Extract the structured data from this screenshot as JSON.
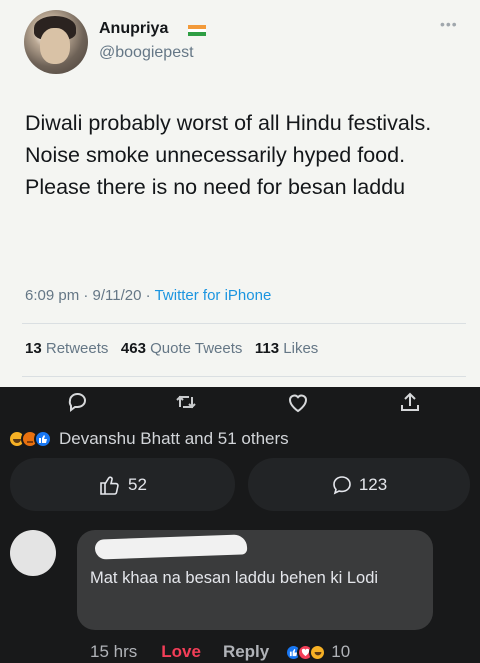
{
  "tweet": {
    "user_name": "Anupriya",
    "handle": "@boogiepest",
    "text": "Diwali probably worst of all Hindu festivals. Noise smoke unnecessarily hyped food. Please there is no need for besan laddu",
    "time": "6:09 pm",
    "date": "9/11/20",
    "source": "Twitter for iPhone",
    "retweets_count": "13",
    "retweets_label": "Retweets",
    "quote_count": "463",
    "quote_label": "Quote Tweets",
    "likes_count": "113",
    "likes_label": "Likes",
    "icons": [
      "more-icon",
      "reply-icon",
      "retweet-icon",
      "like-icon",
      "share-icon",
      "flag-icon"
    ]
  },
  "facebook": {
    "reactions_summary": "Devanshu Bhatt and 51 others",
    "reaction_icons": [
      "haha-icon",
      "angry-icon",
      "like-icon"
    ],
    "like_button_count": "52",
    "comment_button_count": "123",
    "comment": {
      "text": "Mat khaa na besan laddu behen ki Lodi",
      "time": "15 hrs",
      "love_label": "Love",
      "reply_label": "Reply",
      "reactions_count": "10",
      "reaction_icons": [
        "like-icon",
        "love-icon",
        "haha-icon"
      ]
    }
  },
  "colors": {
    "tweet_bg": "#f4f5f2",
    "twitter_blue": "#1b95e0",
    "fb_bg": "#18191a",
    "fb_button_bg": "#222426",
    "love_red": "#f33e58"
  }
}
